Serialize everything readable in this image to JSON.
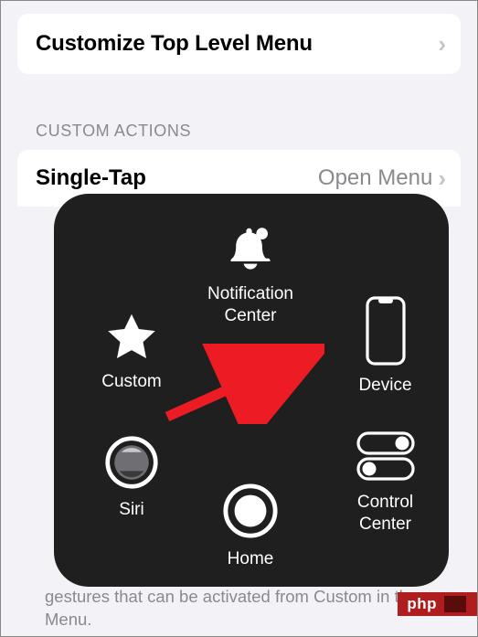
{
  "top_row": {
    "title": "Customize Top Level Menu"
  },
  "section": {
    "header": "CUSTOM ACTIONS"
  },
  "single_tap": {
    "label": "Single-Tap",
    "value": "Open Menu"
  },
  "menu": {
    "notification": "Notification\nCenter",
    "custom": "Custom",
    "device": "Device",
    "siri": "Siri",
    "control": "Control\nCenter",
    "home": "Home"
  },
  "footer": "gestures that can be activated from Custom in the Menu.",
  "watermark": "php"
}
